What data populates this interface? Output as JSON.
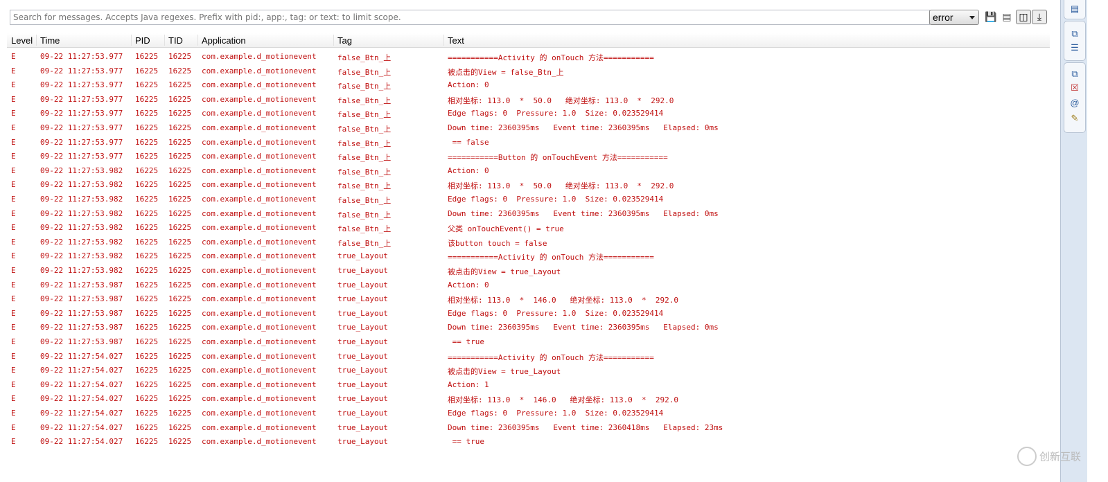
{
  "toolbar": {
    "search_placeholder": "Search for messages. Accepts Java regexes. Prefix with pid:, app:, tag: or text: to limit scope.",
    "level_selected": "error",
    "icons": [
      "save-icon",
      "clear-log-icon",
      "toggle-panel-icon",
      "scroll-lock-icon"
    ]
  },
  "columns": [
    "Level",
    "Time",
    "PID",
    "TID",
    "Application",
    "Tag",
    "Text"
  ],
  "log_color": "#c01010",
  "rows": [
    [
      "E",
      "09-22 11:27:53.977",
      "16225",
      "16225",
      "com.example.d_motionevent",
      "false_Btn_上",
      "===========Activity 的 onTouch 方法==========="
    ],
    [
      "E",
      "09-22 11:27:53.977",
      "16225",
      "16225",
      "com.example.d_motionevent",
      "false_Btn_上",
      "被点击的View = false_Btn_上"
    ],
    [
      "E",
      "09-22 11:27:53.977",
      "16225",
      "16225",
      "com.example.d_motionevent",
      "false_Btn_上",
      "Action: 0"
    ],
    [
      "E",
      "09-22 11:27:53.977",
      "16225",
      "16225",
      "com.example.d_motionevent",
      "false_Btn_上",
      "相对坐标: 113.0  *  50.0   绝对坐标: 113.0  *  292.0"
    ],
    [
      "E",
      "09-22 11:27:53.977",
      "16225",
      "16225",
      "com.example.d_motionevent",
      "false_Btn_上",
      "Edge flags: 0  Pressure: 1.0  Size: 0.023529414"
    ],
    [
      "E",
      "09-22 11:27:53.977",
      "16225",
      "16225",
      "com.example.d_motionevent",
      "false_Btn_上",
      "Down time: 2360395ms   Event time: 2360395ms   Elapsed: 0ms"
    ],
    [
      "E",
      "09-22 11:27:53.977",
      "16225",
      "16225",
      "com.example.d_motionevent",
      "false_Btn_上",
      " == false"
    ],
    [
      "E",
      "09-22 11:27:53.977",
      "16225",
      "16225",
      "com.example.d_motionevent",
      "false_Btn_上",
      "===========Button 的 onTouchEvent 方法==========="
    ],
    [
      "E",
      "09-22 11:27:53.982",
      "16225",
      "16225",
      "com.example.d_motionevent",
      "false_Btn_上",
      "Action: 0"
    ],
    [
      "E",
      "09-22 11:27:53.982",
      "16225",
      "16225",
      "com.example.d_motionevent",
      "false_Btn_上",
      "相对坐标: 113.0  *  50.0   绝对坐标: 113.0  *  292.0"
    ],
    [
      "E",
      "09-22 11:27:53.982",
      "16225",
      "16225",
      "com.example.d_motionevent",
      "false_Btn_上",
      "Edge flags: 0  Pressure: 1.0  Size: 0.023529414"
    ],
    [
      "E",
      "09-22 11:27:53.982",
      "16225",
      "16225",
      "com.example.d_motionevent",
      "false_Btn_上",
      "Down time: 2360395ms   Event time: 2360395ms   Elapsed: 0ms"
    ],
    [
      "E",
      "09-22 11:27:53.982",
      "16225",
      "16225",
      "com.example.d_motionevent",
      "false_Btn_上",
      "父类 onTouchEvent() = true"
    ],
    [
      "E",
      "09-22 11:27:53.982",
      "16225",
      "16225",
      "com.example.d_motionevent",
      "false_Btn_上",
      "该button touch = false"
    ],
    [
      "E",
      "09-22 11:27:53.982",
      "16225",
      "16225",
      "com.example.d_motionevent",
      "true_Layout",
      "===========Activity 的 onTouch 方法==========="
    ],
    [
      "E",
      "09-22 11:27:53.982",
      "16225",
      "16225",
      "com.example.d_motionevent",
      "true_Layout",
      "被点击的View = true_Layout"
    ],
    [
      "E",
      "09-22 11:27:53.987",
      "16225",
      "16225",
      "com.example.d_motionevent",
      "true_Layout",
      "Action: 0"
    ],
    [
      "E",
      "09-22 11:27:53.987",
      "16225",
      "16225",
      "com.example.d_motionevent",
      "true_Layout",
      "相对坐标: 113.0  *  146.0   绝对坐标: 113.0  *  292.0"
    ],
    [
      "E",
      "09-22 11:27:53.987",
      "16225",
      "16225",
      "com.example.d_motionevent",
      "true_Layout",
      "Edge flags: 0  Pressure: 1.0  Size: 0.023529414"
    ],
    [
      "E",
      "09-22 11:27:53.987",
      "16225",
      "16225",
      "com.example.d_motionevent",
      "true_Layout",
      "Down time: 2360395ms   Event time: 2360395ms   Elapsed: 0ms"
    ],
    [
      "E",
      "09-22 11:27:53.987",
      "16225",
      "16225",
      "com.example.d_motionevent",
      "true_Layout",
      " == true"
    ],
    [
      "E",
      "09-22 11:27:54.027",
      "16225",
      "16225",
      "com.example.d_motionevent",
      "true_Layout",
      "===========Activity 的 onTouch 方法==========="
    ],
    [
      "E",
      "09-22 11:27:54.027",
      "16225",
      "16225",
      "com.example.d_motionevent",
      "true_Layout",
      "被点击的View = true_Layout"
    ],
    [
      "E",
      "09-22 11:27:54.027",
      "16225",
      "16225",
      "com.example.d_motionevent",
      "true_Layout",
      "Action: 1"
    ],
    [
      "E",
      "09-22 11:27:54.027",
      "16225",
      "16225",
      "com.example.d_motionevent",
      "true_Layout",
      "相对坐标: 113.0  *  146.0   绝对坐标: 113.0  *  292.0"
    ],
    [
      "E",
      "09-22 11:27:54.027",
      "16225",
      "16225",
      "com.example.d_motionevent",
      "true_Layout",
      "Edge flags: 0  Pressure: 1.0  Size: 0.023529414"
    ],
    [
      "E",
      "09-22 11:27:54.027",
      "16225",
      "16225",
      "com.example.d_motionevent",
      "true_Layout",
      "Down time: 2360395ms   Event time: 2360418ms   Elapsed: 23ms"
    ],
    [
      "E",
      "09-22 11:27:54.027",
      "16225",
      "16225",
      "com.example.d_motionevent",
      "true_Layout",
      " == true"
    ]
  ],
  "watermark": "创新互联"
}
